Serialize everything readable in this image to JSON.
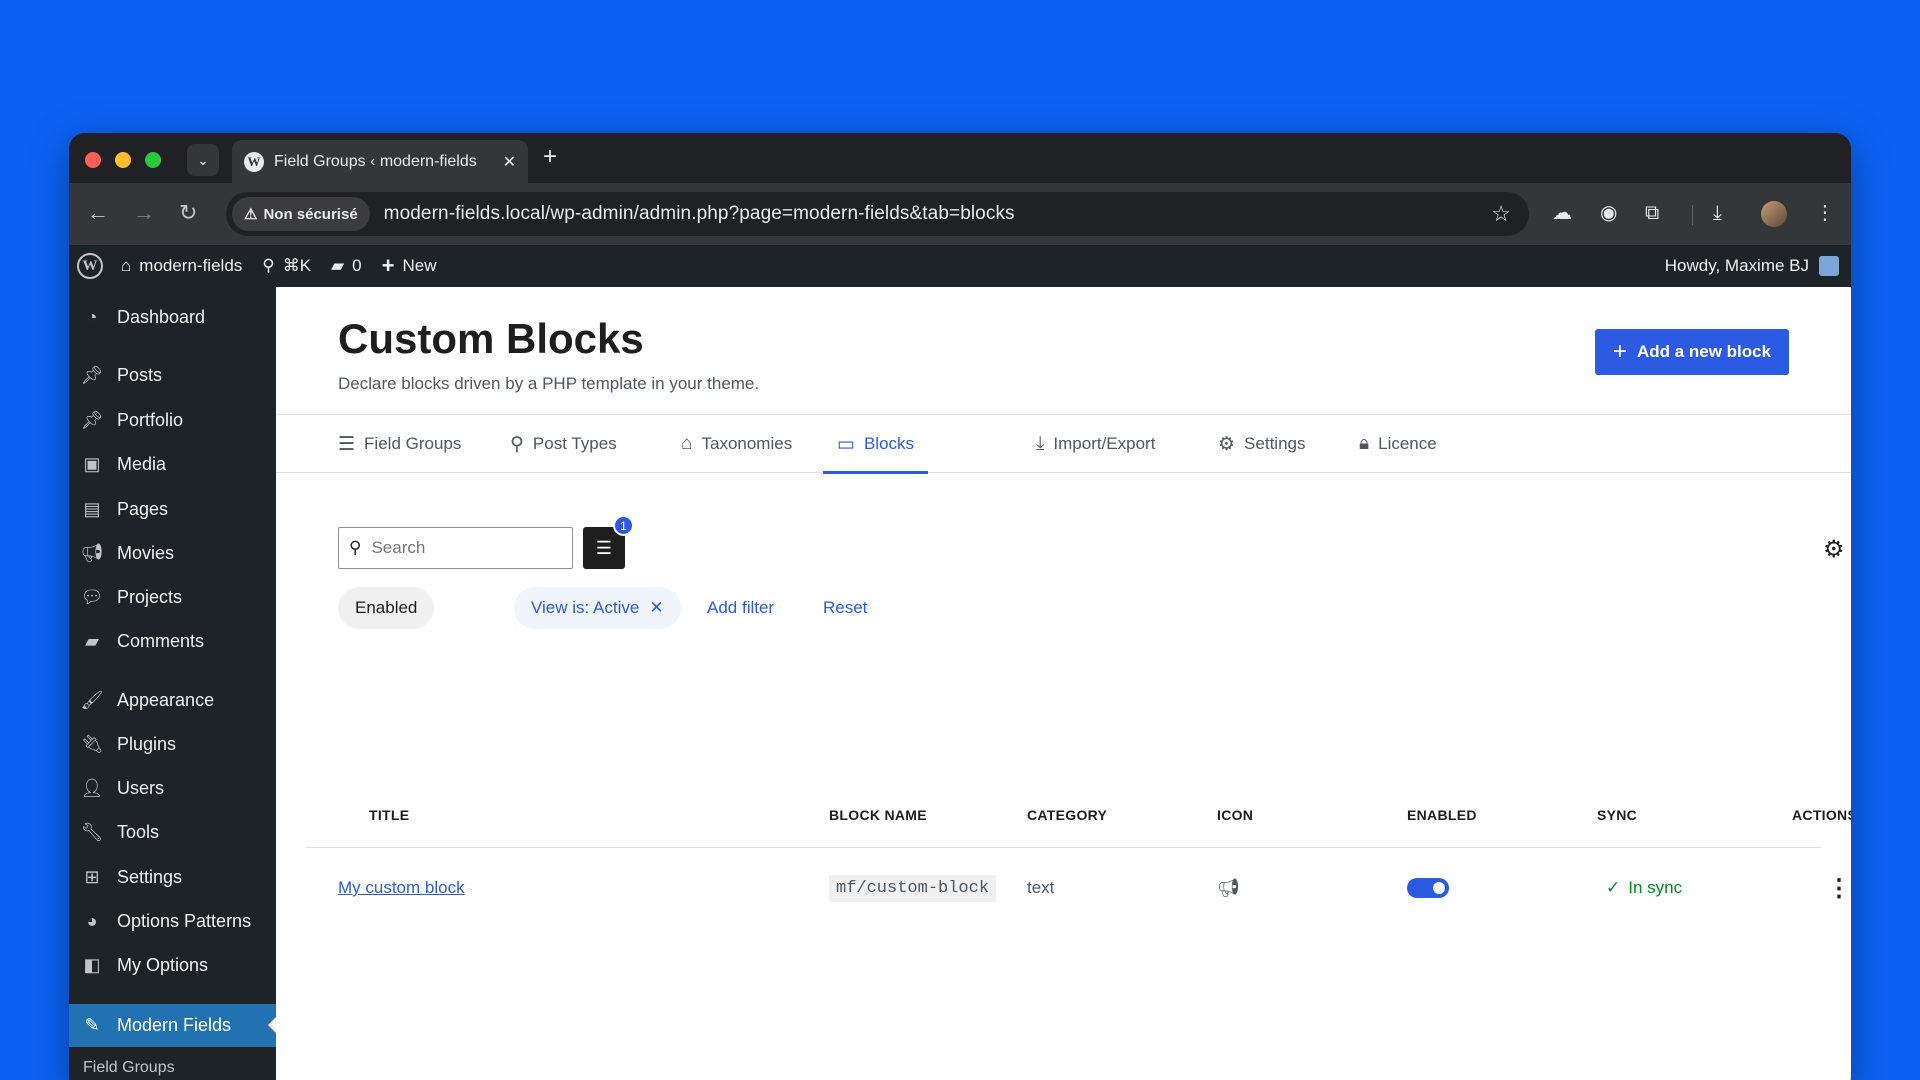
{
  "browser": {
    "tab_title": "Field Groups ‹ modern-fields",
    "security_label": "Non sécurisé",
    "url": "modern-fields.local/wp-admin/admin.php?page=modern-fields&tab=blocks"
  },
  "adminbar": {
    "site_name": "modern-fields",
    "shortcut": "⌘K",
    "comments_count": "0",
    "new_label": "New",
    "howdy": "Howdy, Maxime BJ"
  },
  "sidebar": {
    "items": [
      {
        "label": "Dashboard",
        "icon": "dashboard-icon"
      },
      {
        "label": "Posts",
        "icon": "pin-icon"
      },
      {
        "label": "Portfolio",
        "icon": "pin-icon"
      },
      {
        "label": "Media",
        "icon": "media-icon"
      },
      {
        "label": "Pages",
        "icon": "pages-icon"
      },
      {
        "label": "Movies",
        "icon": "megaphone-icon"
      },
      {
        "label": "Projects",
        "icon": "speech-bubble-icon"
      },
      {
        "label": "Comments",
        "icon": "comment-icon"
      },
      {
        "label": "Appearance",
        "icon": "brush-icon"
      },
      {
        "label": "Plugins",
        "icon": "plugin-icon"
      },
      {
        "label": "Users",
        "icon": "user-icon"
      },
      {
        "label": "Tools",
        "icon": "wrench-icon"
      },
      {
        "label": "Settings",
        "icon": "sliders-icon"
      },
      {
        "label": "Options Patterns",
        "icon": "palette-icon"
      },
      {
        "label": "My Options",
        "icon": "options-icon"
      },
      {
        "label": "Modern Fields",
        "icon": "modern-fields-icon"
      }
    ],
    "submenu_peek": "Field Groups"
  },
  "page": {
    "title": "Custom Blocks",
    "description": "Declare blocks driven by a PHP template in your theme.",
    "add_button": "Add a new block"
  },
  "tabs": [
    {
      "label": "Field Groups",
      "icon": "list-icon"
    },
    {
      "label": "Post Types",
      "icon": "pin-icon"
    },
    {
      "label": "Taxonomies",
      "icon": "tag-icon"
    },
    {
      "label": "Blocks",
      "icon": "calendar-icon",
      "active": true
    },
    {
      "label": "Import/Export",
      "icon": "download-icon"
    },
    {
      "label": "Settings",
      "icon": "gear-icon"
    },
    {
      "label": "Licence",
      "icon": "lock-icon"
    }
  ],
  "toolbar": {
    "search_placeholder": "Search",
    "filter_count": "1"
  },
  "filters": {
    "enabled_chip": "Enabled",
    "view_chip": "View is: Active",
    "add_filter": "Add filter",
    "reset": "Reset"
  },
  "table": {
    "columns": [
      "TITLE",
      "BLOCK NAME",
      "CATEGORY",
      "ICON",
      "ENABLED",
      "SYNC",
      "ACTIONS"
    ],
    "rows": [
      {
        "title": "My custom block",
        "block_name": "mf/custom-block",
        "category": "text",
        "icon": "megaphone-icon",
        "enabled": true,
        "sync": "In sync"
      }
    ]
  },
  "colors": {
    "accent": "#2d5ae3",
    "background": "#0b62f2",
    "admin_dark": "#1d2327",
    "sync_green": "#008a20"
  }
}
